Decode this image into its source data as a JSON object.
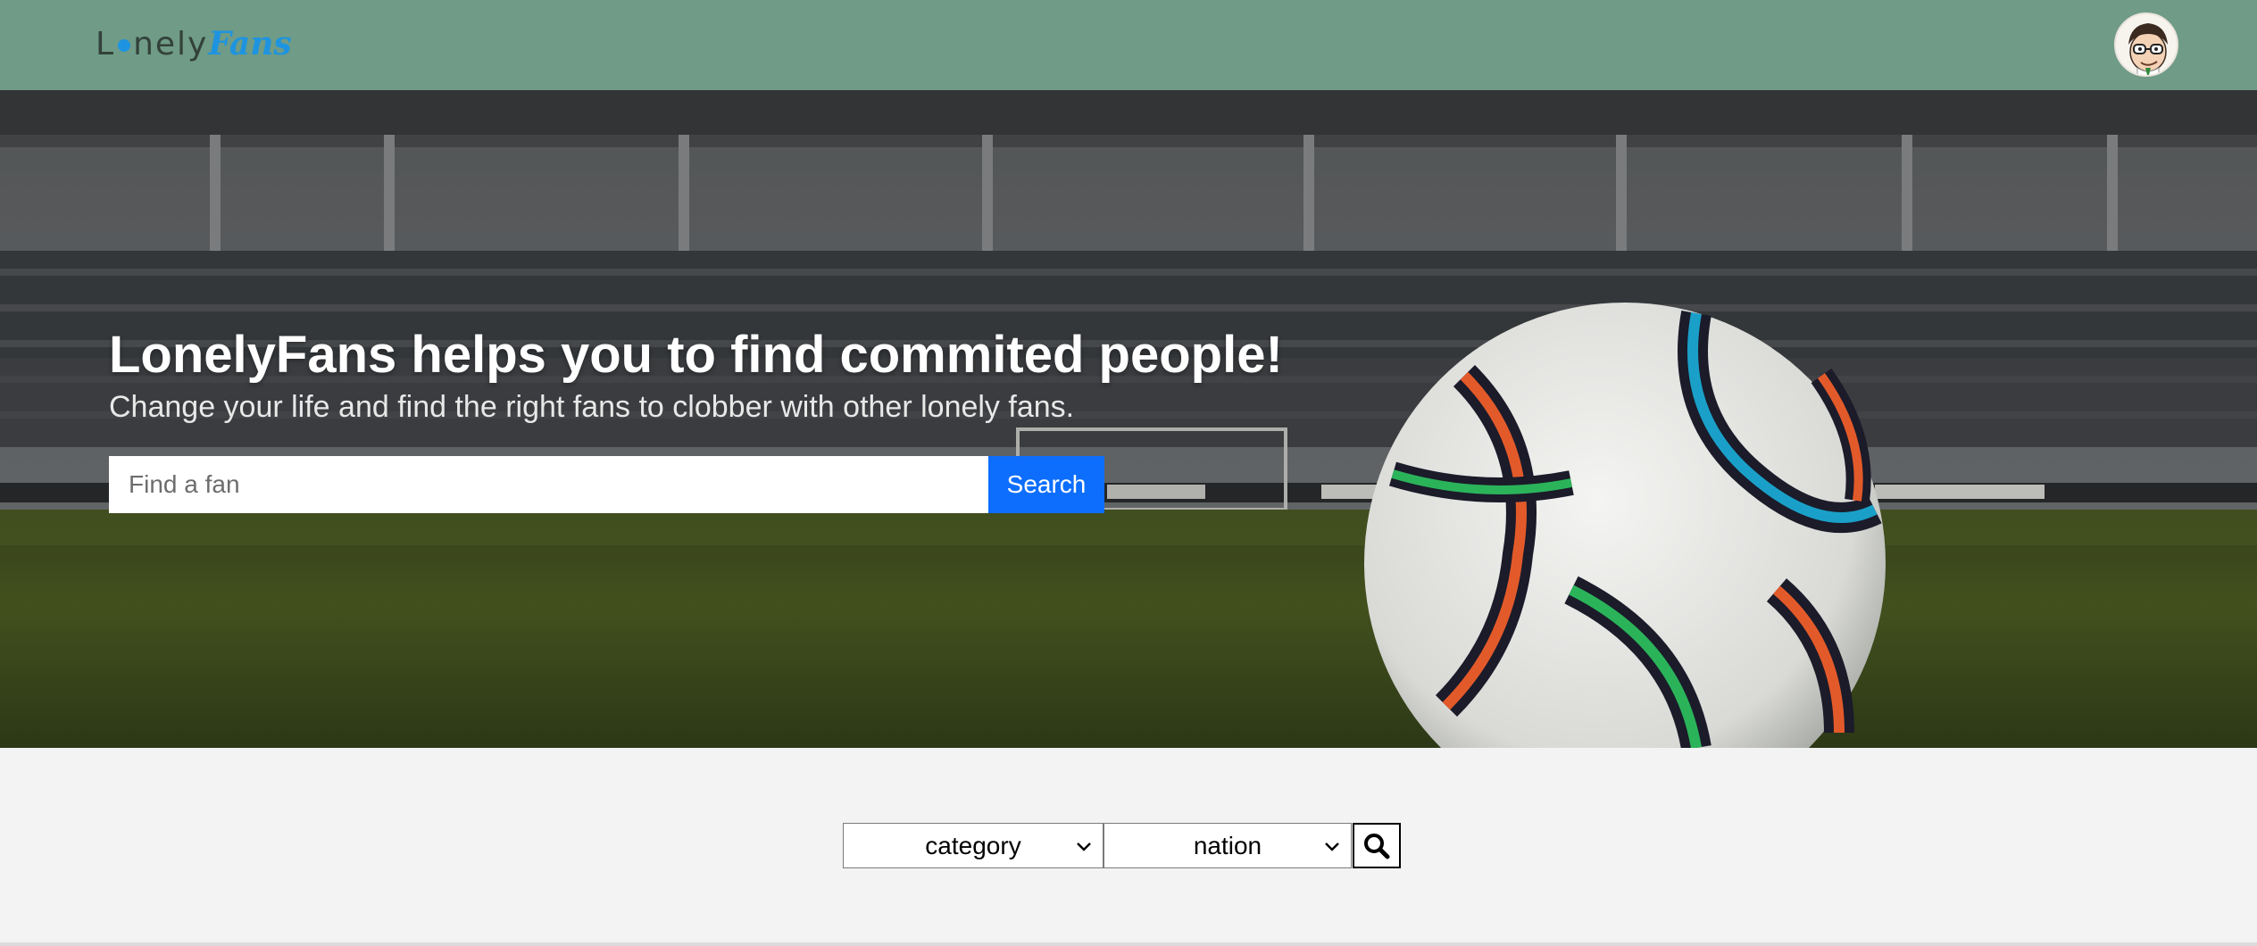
{
  "header": {
    "logo": {
      "part1": "L",
      "part2": "nely",
      "part3": "Fans"
    },
    "avatar_icon": "user-avatar-icon"
  },
  "hero": {
    "title": "LonelyFans helps you to find commited people!",
    "subtitle": "Change your life and find the right fans to clobber with other lonely fans.",
    "search": {
      "placeholder": "Find a fan",
      "value": "",
      "button_label": "Search"
    }
  },
  "filter": {
    "category": {
      "selected": "category"
    },
    "nation": {
      "selected": "nation"
    },
    "search_icon": "search-icon"
  },
  "colors": {
    "header_bg": "#6f9b87",
    "primary_button": "#0d6efd",
    "logo_accent": "#1e94e0",
    "page_bg": "#f3f3f3"
  }
}
